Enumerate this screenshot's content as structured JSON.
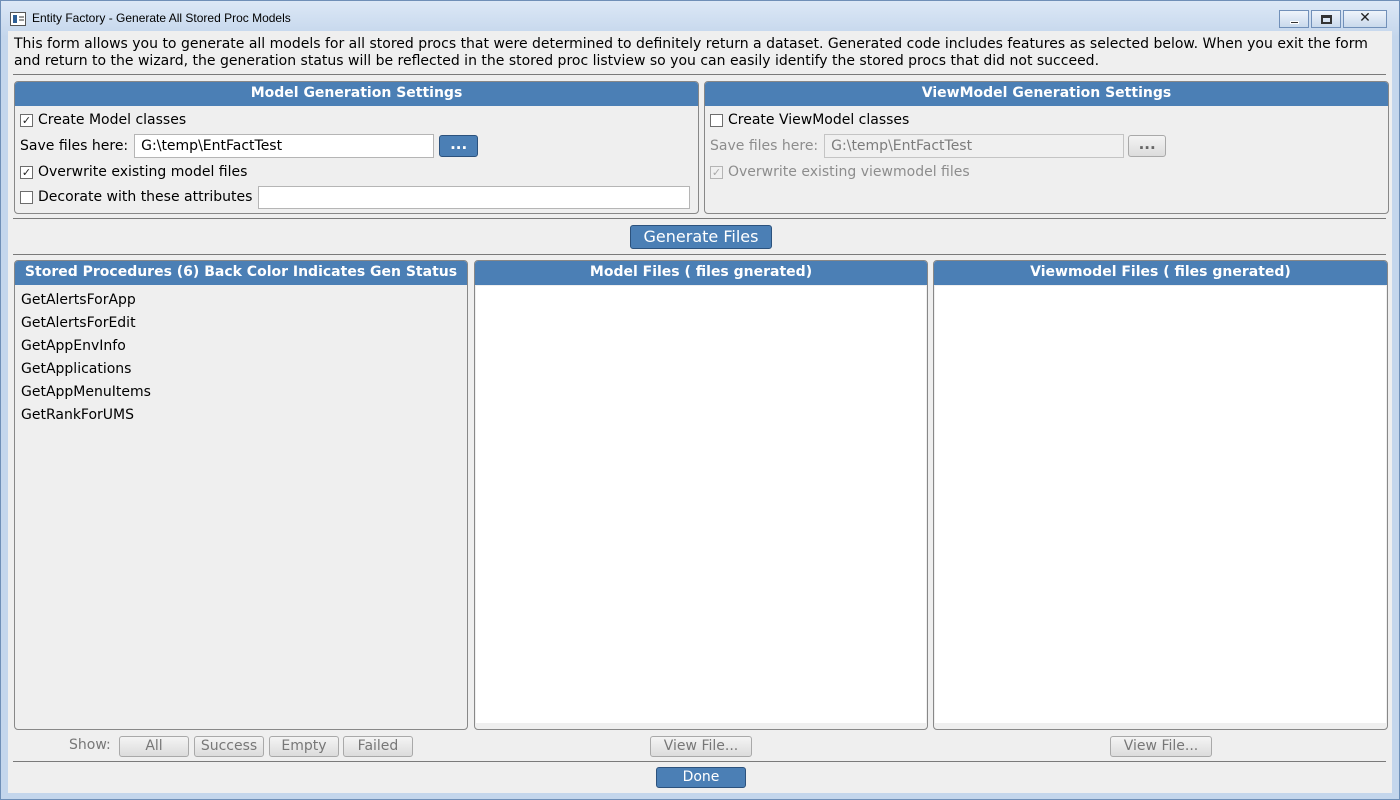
{
  "window": {
    "title": "Entity Factory - Generate All Stored Proc Models",
    "minimize_glyph": "",
    "close_glyph": "✕"
  },
  "intro": {
    "text": "This form allows you to generate all models for all stored procs that were determined to definitely return a dataset. Generated code includes features as selected below. When you exit the form and return to the wizard, the generation status will be reflected in the stored proc listview so you can easily identify the stored procs that did not succeed."
  },
  "model_settings": {
    "header": "Model Generation Settings",
    "create_label": "Create Model classes",
    "create_checked": true,
    "save_label": "Save files here:",
    "save_path": "G:\\temp\\EntFactTest",
    "browse_label": "...",
    "overwrite_label": "Overwrite existing model files",
    "overwrite_checked": true,
    "decorate_label": "Decorate with these attributes",
    "decorate_checked": false,
    "decorate_value": ""
  },
  "viewmodel_settings": {
    "header": "ViewModel Generation Settings",
    "create_label": "Create ViewModel classes",
    "create_checked": false,
    "save_label": "Save files here:",
    "save_path": "G:\\temp\\EntFactTest",
    "browse_label": "...",
    "overwrite_label": "Overwrite existing viewmodel files",
    "overwrite_checked": true
  },
  "generate_button": "Generate Files",
  "stored_procs": {
    "header": "Stored Procedures (6) Back Color Indicates Gen Status",
    "items": [
      "GetAlertsForApp",
      "GetAlertsForEdit",
      "GetAppEnvInfo",
      "GetApplications",
      "GetAppMenuItems",
      "GetRankForUMS"
    ]
  },
  "model_files": {
    "header": "Model Files ( files gnerated)",
    "view_button": "View File..."
  },
  "viewmodel_files": {
    "header": "Viewmodel Files ( files gnerated)",
    "view_button": "View File..."
  },
  "filters": {
    "show_label": "Show:",
    "all": "All",
    "success": "Success",
    "empty": "Empty",
    "failed": "Failed"
  },
  "done_button": "Done",
  "colors": {
    "accent": "#4b7fb5",
    "title_bar": "#c4d6ec",
    "background": "#efefef"
  },
  "icons": {
    "app": "app-icon",
    "minimize": "minimize-icon",
    "maximize": "maximize-icon",
    "close": "close-icon",
    "check": "✓"
  }
}
